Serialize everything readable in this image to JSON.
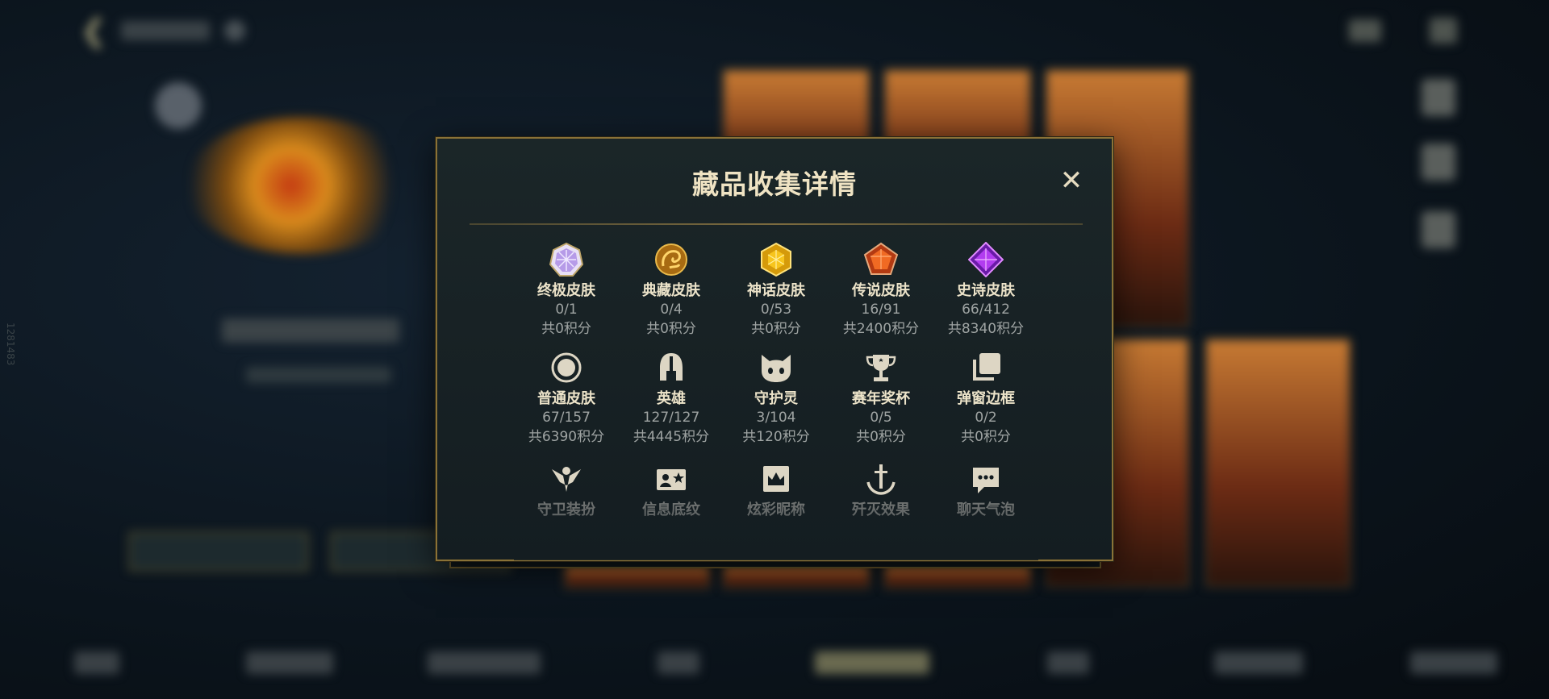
{
  "dialog": {
    "title": "藏品收集详情",
    "close_label": "✕"
  },
  "collection_rows": [
    [
      {
        "name": "终极皮肤",
        "count": "0/1",
        "points": "共0积分",
        "icon": "ultimate-skin-icon"
      },
      {
        "name": "典藏皮肤",
        "count": "0/4",
        "points": "共0积分",
        "icon": "legacy-skin-icon"
      },
      {
        "name": "神话皮肤",
        "count": "0/53",
        "points": "共0积分",
        "icon": "mythic-skin-icon"
      },
      {
        "name": "传说皮肤",
        "count": "16/91",
        "points": "共2400积分",
        "icon": "legendary-skin-icon"
      },
      {
        "name": "史诗皮肤",
        "count": "66/412",
        "points": "共8340积分",
        "icon": "epic-skin-icon"
      }
    ],
    [
      {
        "name": "普通皮肤",
        "count": "67/157",
        "points": "共6390积分",
        "icon": "standard-skin-icon"
      },
      {
        "name": "英雄",
        "count": "127/127",
        "points": "共4445积分",
        "icon": "champion-helmet-icon"
      },
      {
        "name": "守护灵",
        "count": "3/104",
        "points": "共120积分",
        "icon": "ward-spirit-icon"
      },
      {
        "name": "赛年奖杯",
        "count": "0/5",
        "points": "共0积分",
        "icon": "season-trophy-icon"
      },
      {
        "name": "弹窗边框",
        "count": "0/2",
        "points": "共0积分",
        "icon": "popup-frame-icon"
      }
    ],
    [
      {
        "name": "守卫装扮",
        "icon": "guardian-outfit-icon"
      },
      {
        "name": "信息底纹",
        "icon": "info-background-icon"
      },
      {
        "name": "炫彩昵称",
        "icon": "colorful-nickname-icon"
      },
      {
        "name": "歼灭效果",
        "icon": "annihilation-effect-icon"
      },
      {
        "name": "聊天气泡",
        "icon": "chat-bubble-icon"
      }
    ]
  ],
  "background": {
    "side_number": "1281483"
  },
  "colors": {
    "dialog_border": "#8a7237",
    "title": "#efe3c3",
    "accent_gold": "#c8aa6e"
  }
}
